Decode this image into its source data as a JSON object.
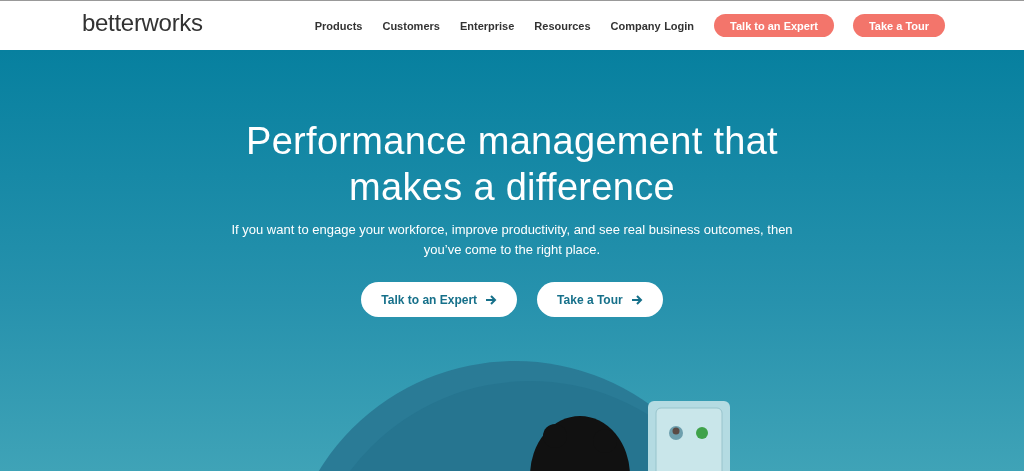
{
  "header": {
    "logo": "betterworks",
    "nav": [
      "Products",
      "Customers",
      "Enterprise",
      "Resources",
      "Company"
    ],
    "login": "Login",
    "buttons": [
      "Talk to an Expert",
      "Take a Tour"
    ]
  },
  "hero": {
    "title": "Performance management that makes a difference",
    "subtitle": "If you want to engage your workforce, improve productivity, and see real business outcomes, then you’ve come to the right place.",
    "buttons": [
      "Talk to an Expert",
      "Take a Tour"
    ]
  }
}
